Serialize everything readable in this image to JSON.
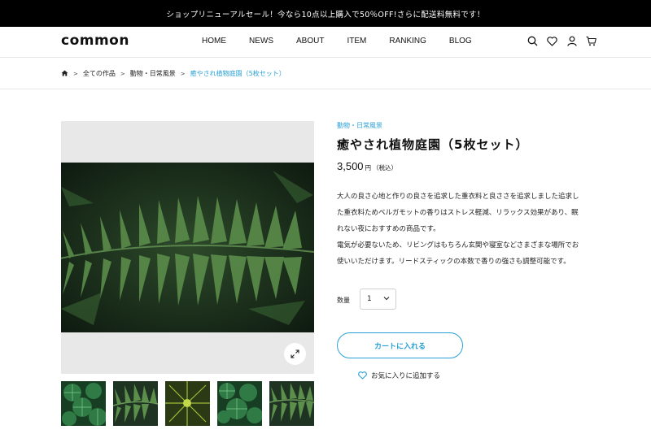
{
  "announcement": "ショップリニューアルセール！今なら10点以上購入で50％OFF!さらに配送料無料です！",
  "header": {
    "logo": "common",
    "nav": [
      "HOME",
      "NEWS",
      "ABOUT",
      "ITEM",
      "RANKING",
      "BLOG"
    ],
    "icons": [
      "search-icon",
      "heart-icon",
      "user-icon",
      "cart-icon"
    ]
  },
  "breadcrumb": [
    "全ての作品",
    "動物・日常風景",
    "癒やされ植物庭園（5枚セット）"
  ],
  "product": {
    "category": "動物・日常風景",
    "title": "癒やされ植物庭園（5枚セット）",
    "price": "3,500",
    "price_unit": "円",
    "tax_note": "（税込）",
    "description": [
      "大人の良さ心地と作りの良さを追求した重衣料と良ささを追求しました追求し",
      "た重衣料ためベルガモットの香りはストレス軽減、リラックス効果があり、眠",
      "れない夜におすすめの商品です。",
      "電気が必要ないため、リビングはもちろん玄関や寝室などさまざまな場所でお",
      "使いいただけます。リードスティックの本数で香りの強さも調整可能です。"
    ],
    "quantity_label": "数量",
    "quantity_value": "1",
    "cart_button": "カートに入れる",
    "favorite_link": "お気に入りに追加する"
  },
  "colors": {
    "accent": "#2aa0d6",
    "announcement_bg": "#000000"
  }
}
